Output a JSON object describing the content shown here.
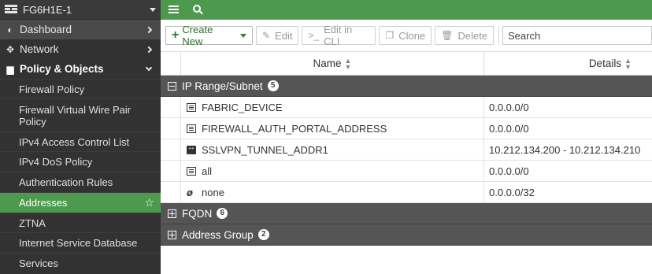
{
  "sidebar": {
    "device_name": "FG6H1E-1",
    "top_items": [
      {
        "label": "Dashboard",
        "icon": "dashboard-icon"
      },
      {
        "label": "Network",
        "icon": "network-icon"
      },
      {
        "label": "Policy & Objects",
        "icon": "policy-icon"
      }
    ],
    "sub_items": [
      {
        "label": "Firewall Policy"
      },
      {
        "label": "Firewall Virtual Wire Pair Policy"
      },
      {
        "label": "IPv4 Access Control List"
      },
      {
        "label": "IPv4 DoS Policy"
      },
      {
        "label": "Authentication Rules"
      },
      {
        "label": "Addresses"
      },
      {
        "label": "ZTNA"
      },
      {
        "label": "Internet Service Database"
      },
      {
        "label": "Services"
      }
    ]
  },
  "toolbar": {
    "create_new": "Create New",
    "edit": "Edit",
    "edit_cli": "Edit in CLI",
    "clone": "Clone",
    "delete": "Delete",
    "search_placeholder": "Search"
  },
  "table": {
    "columns": [
      "Name",
      "Details"
    ],
    "groups": [
      {
        "label": "IP Range/Subnet",
        "count": "5",
        "expanded": true,
        "rows": [
          {
            "name": "FABRIC_DEVICE",
            "details": "0.0.0.0/0",
            "icon": "subnet-icon"
          },
          {
            "name": "FIREWALL_AUTH_PORTAL_ADDRESS",
            "details": "0.0.0.0/0",
            "icon": "subnet-icon"
          },
          {
            "name": "SSLVPN_TUNNEL_ADDR1",
            "details": "10.212.134.200 - 10.212.134.210",
            "icon": "iprange-icon"
          },
          {
            "name": "all",
            "details": "0.0.0.0/0",
            "icon": "subnet-icon"
          },
          {
            "name": "none",
            "details": "0.0.0.0/32",
            "icon": "none-address-icon"
          }
        ]
      },
      {
        "label": "FQDN",
        "count": "6",
        "expanded": false
      },
      {
        "label": "Address Group",
        "count": "2",
        "expanded": false
      }
    ]
  },
  "colors": {
    "accent_green": "#4d9a4e",
    "sidebar_bg": "#323232",
    "group_header_bg": "#555555"
  }
}
